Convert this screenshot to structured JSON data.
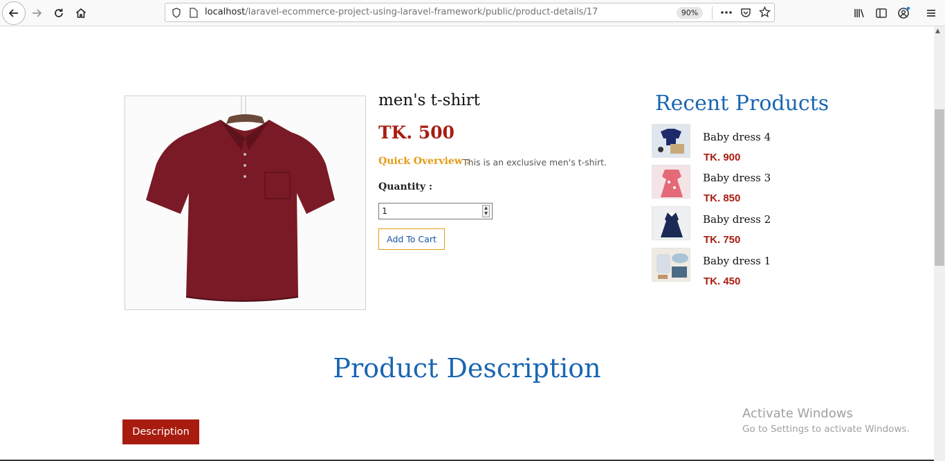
{
  "browser": {
    "url_host": "localhost",
    "url_path": "/laravel-ecommerce-project-using-laravel-framework/public/product-details/17",
    "zoom": "90%"
  },
  "product": {
    "name": "men's t-shirt",
    "price": "TK. 500",
    "overview_label": "Quick Overview :",
    "overview_text": "This is an exclusive men's t-shirt.",
    "quantity_label": "Quantity :",
    "quantity_value": "1",
    "add_to_cart_label": "Add To Cart",
    "shirt_color": "#7a1a26"
  },
  "recent": {
    "title": "Recent Products",
    "items": [
      {
        "name": "Baby dress 4",
        "price": "TK. 900"
      },
      {
        "name": "Baby dress 3",
        "price": "TK. 850"
      },
      {
        "name": "Baby dress 2",
        "price": "TK. 750"
      },
      {
        "name": "Baby dress 1",
        "price": "TK. 450"
      }
    ]
  },
  "description": {
    "title": "Product Description",
    "tab_label": "Description"
  },
  "watermark": {
    "line1": "Activate Windows",
    "line2": "Go to Settings to activate Windows."
  },
  "colors": {
    "accent_blue": "#1a66b3",
    "price_red": "#a81c10",
    "overview_orange": "#e39b16"
  }
}
